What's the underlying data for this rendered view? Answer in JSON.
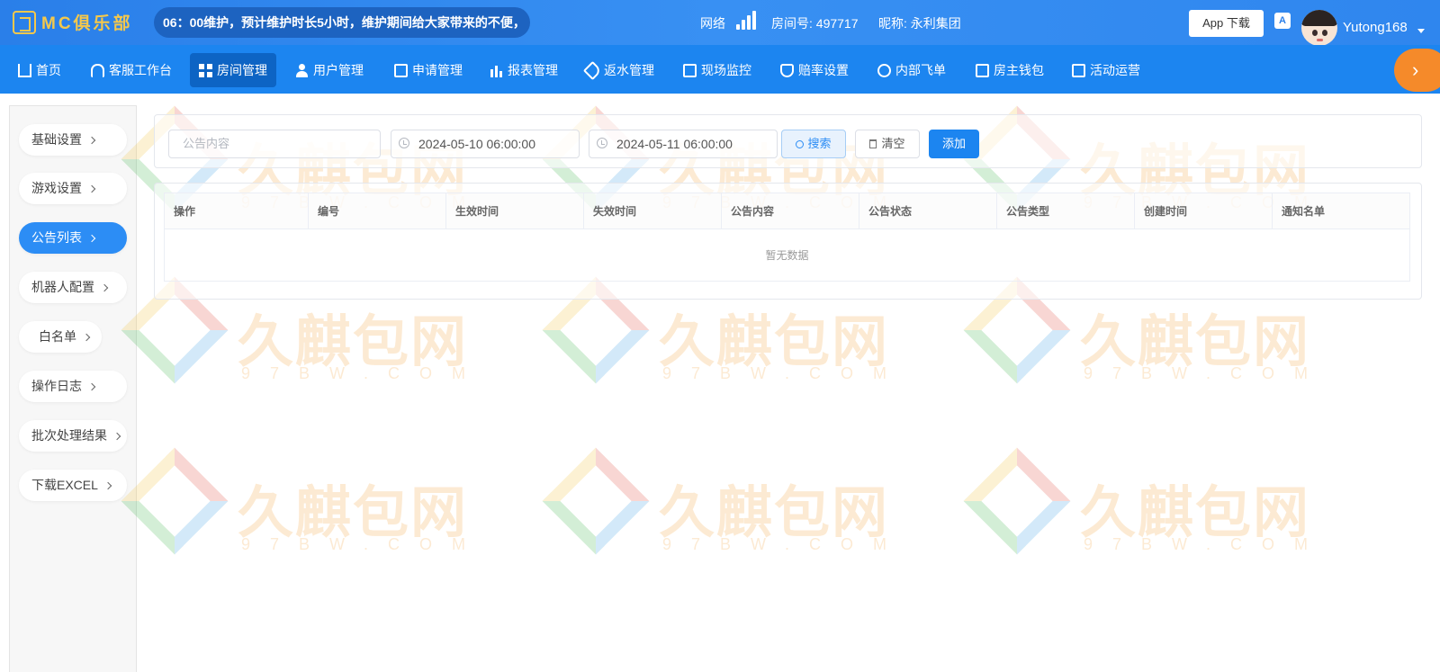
{
  "header": {
    "logo_text": "MC俱乐部",
    "announcement": "06：00维护，预计维护时长5小时，维护期间给大家带来的不便，",
    "network_label": "网络",
    "room_number": "房间号: 497717",
    "nickname": "昵称: 永利集团",
    "app_download": "App 下载",
    "lang_icon_text": "A",
    "username": "Yutong168"
  },
  "nav": {
    "items": [
      {
        "label": "首页",
        "icon": "home-icon"
      },
      {
        "label": "客服工作台",
        "icon": "headset-icon"
      },
      {
        "label": "房间管理",
        "icon": "grid-icon",
        "active": true
      },
      {
        "label": "用户管理",
        "icon": "user-icon"
      },
      {
        "label": "申请管理",
        "icon": "document-icon"
      },
      {
        "label": "报表管理",
        "icon": "bar-chart-icon"
      },
      {
        "label": "返水管理",
        "icon": "tag-icon"
      },
      {
        "label": "现场监控",
        "icon": "monitor-icon"
      },
      {
        "label": "赔率设置",
        "icon": "shield-icon"
      },
      {
        "label": "内部飞单",
        "icon": "refresh-icon"
      },
      {
        "label": "房主钱包",
        "icon": "wallet-icon"
      },
      {
        "label": "活动运营",
        "icon": "gift-icon"
      }
    ],
    "more_arrow": "›"
  },
  "sidebar": {
    "items": [
      {
        "label": "基础设置"
      },
      {
        "label": "游戏设置"
      },
      {
        "label": "公告列表",
        "active": true
      },
      {
        "label": "机器人配置"
      },
      {
        "label": "白名单"
      },
      {
        "label": "操作日志"
      },
      {
        "label": "批次处理结果"
      },
      {
        "label": "下载EXCEL"
      }
    ]
  },
  "filters": {
    "content_placeholder": "公告内容",
    "start_time": "2024-05-10 06:00:00",
    "end_time": "2024-05-11 06:00:00",
    "search_label": "搜索",
    "clear_label": "清空",
    "add_label": "添加"
  },
  "table": {
    "columns": [
      "操作",
      "编号",
      "生效时间",
      "失效时间",
      "公告内容",
      "公告状态",
      "公告类型",
      "创建时间",
      "通知名单"
    ],
    "empty_text": "暂无数据"
  },
  "watermark": {
    "cn": "久麒包网",
    "en": "97BW.COM"
  },
  "colors": {
    "header_blue": "#2a7fe9",
    "nav_blue": "#1c85f0",
    "nav_active": "#0d64c4",
    "accent_orange": "#f58a2a",
    "logo_gold": "#f4c84c",
    "sidebar_active": "#2c8df5"
  }
}
